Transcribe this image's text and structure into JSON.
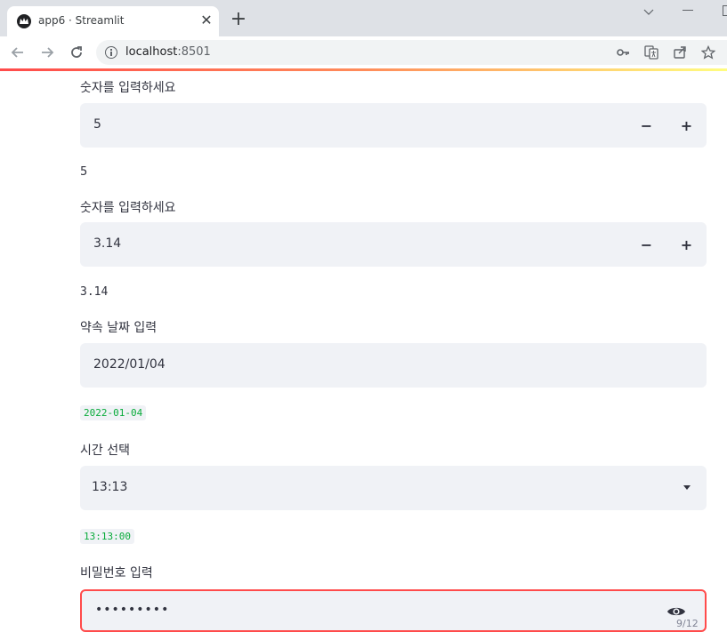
{
  "browser": {
    "tab_title": "app6 · Streamlit",
    "url_host": "localhost",
    "url_port": ":8501"
  },
  "icons": {
    "favicon": "streamlit-crown-icon",
    "tab_close": "close-icon",
    "new_tab": "plus-icon",
    "back": "arrow-left-icon",
    "forward": "arrow-right-icon",
    "reload": "reload-icon",
    "site_info": "info-icon",
    "key": "key-icon",
    "translate": "translate-icon",
    "share": "share-icon",
    "bookmark": "star-icon",
    "step_minus": "minus-icon",
    "step_plus": "plus-icon",
    "dropdown": "caret-down-icon",
    "password_visibility": "eye-icon"
  },
  "colors": {
    "accent": "#ff4b4b",
    "code_text": "#09ab3b",
    "input_bg": "#f0f2f6"
  },
  "form": {
    "int_input": {
      "label": "숫자를 입력하세요",
      "value": "5",
      "minus": "−",
      "plus": "+"
    },
    "int_output": "5",
    "float_input": {
      "label": "숫자를 입력하세요",
      "value": "3.14",
      "minus": "−",
      "plus": "+"
    },
    "float_output": "3.14",
    "date_input": {
      "label": "약속 날짜 입력",
      "value": "2022/01/04"
    },
    "date_output": "2022-01-04",
    "time_input": {
      "label": "시간 선택",
      "value": "13:13"
    },
    "time_output": "13:13:00",
    "password_input": {
      "label": "비밀번호 입력",
      "value": "•••••••••",
      "char_count": "9/12"
    }
  }
}
